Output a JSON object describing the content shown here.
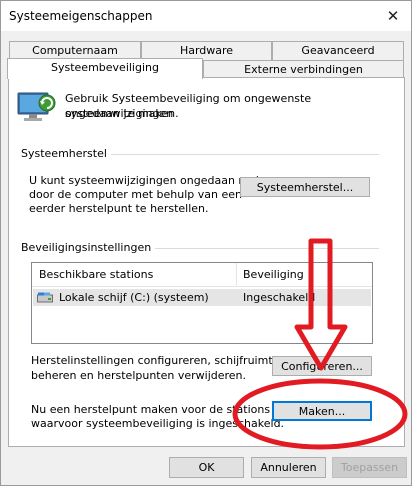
{
  "window": {
    "title": "Systeemeigenschappen",
    "close_glyph": "✕"
  },
  "tabs": {
    "row1": [
      "Computernaam",
      "Hardware",
      "Geavanceerd"
    ],
    "row2": [
      "Systeembeveiliging",
      "Externe verbindingen"
    ],
    "active": "Systeembeveiliging"
  },
  "intro": {
    "line1": "Gebruik Systeembeveiliging om ongewenste systeemwijzigingen",
    "line2": "ongedaan te maken."
  },
  "system_restore": {
    "group_label": "Systeemherstel",
    "desc_line1": "U kunt systeemwijzigingen ongedaan maken",
    "desc_line2": "door de computer met behulp van een",
    "desc_line3": "eerder herstelpunt te herstellen.",
    "button_label": "Systeemherstel..."
  },
  "protection_settings": {
    "group_label": "Beveiligingsinstellingen",
    "columns": [
      "Beschikbare stations",
      "Beveiliging"
    ],
    "rows": [
      {
        "drive": "Lokale schijf (C:) (systeem)",
        "status": "Ingeschakeld",
        "icon": "drive-icon"
      }
    ],
    "configure_desc_line1": "Herstelinstellingen configureren, schijfruimte",
    "configure_desc_line2": "beheren en herstelpunten verwijderen.",
    "configure_button": "Configureren...",
    "create_desc_line1": "Nu een herstelpunt maken voor de stations",
    "create_desc_line2": "waarvoor systeembeveiliging is ingeschakeld.",
    "create_button": "Maken..."
  },
  "footer": {
    "ok": "OK",
    "cancel": "Annuleren",
    "apply": "Toepassen"
  },
  "annotation": {
    "arrow_color": "#e21b22",
    "ellipse_color": "#e21b22"
  }
}
